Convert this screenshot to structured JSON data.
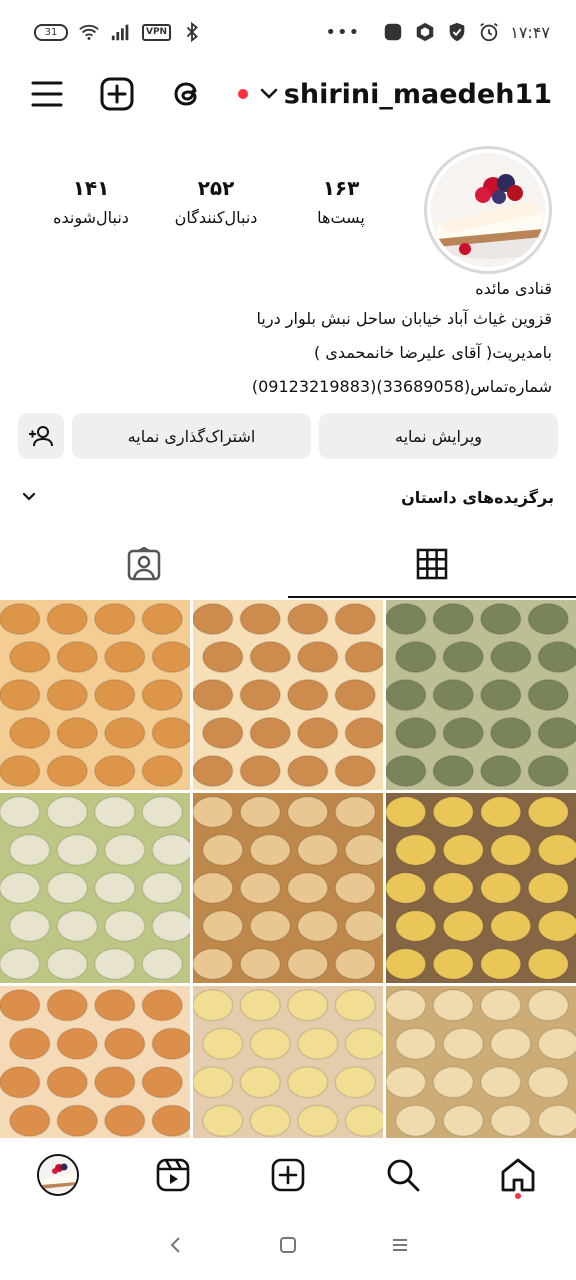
{
  "status_bar": {
    "battery": "31",
    "vpn": "VPN",
    "more": "•••",
    "time": "۱۷:۴۷"
  },
  "header": {
    "username": "shirini_maedeh11"
  },
  "profile": {
    "stats": [
      {
        "number": "۱۶۳",
        "label": "پست‌ها"
      },
      {
        "number": "۲۵۲",
        "label": "دنبال‌کنندگان"
      },
      {
        "number": "۱۴۱",
        "label": "دنبال‌شونده"
      }
    ]
  },
  "bio": {
    "name": "قنادی مائده",
    "lines": [
      "قزوین غیاث آباد خیابان ساحل نبش بلوار دریا",
      "بامدیریت( آقای علیرضا خانمحمدی )",
      "شماره‌تماس(33689058)(09123219883)"
    ]
  },
  "buttons": {
    "edit_profile": "ویرایش نمایه",
    "share_profile": "اشتراک‌گذاری نمایه"
  },
  "highlights": {
    "label": "برگزیده‌های داستان"
  },
  "grid": {
    "posts": [
      {
        "name": "post-1",
        "base": "#d98c3a",
        "accent": "#f2c98a"
      },
      {
        "name": "post-2",
        "base": "#c9823f",
        "accent": "#f6dcb0"
      },
      {
        "name": "post-3",
        "base": "#6f7a4e",
        "accent": "#b9b98c"
      },
      {
        "name": "post-4",
        "base": "#e7e1c8",
        "accent": "#b8c27a"
      },
      {
        "name": "post-5",
        "base": "#e8c38a",
        "accent": "#b97e3c"
      },
      {
        "name": "post-6",
        "base": "#e9c24b",
        "accent": "#7b5a35"
      },
      {
        "name": "post-7",
        "base": "#d9863c",
        "accent": "#f4d7b0"
      },
      {
        "name": "post-8",
        "base": "#f0dc8a",
        "accent": "#e2c8a6"
      },
      {
        "name": "post-9",
        "base": "#eed8a6",
        "accent": "#c9a76a"
      }
    ]
  },
  "colors": {
    "accent_red": "#ff3040",
    "button_bg": "#efefef"
  }
}
